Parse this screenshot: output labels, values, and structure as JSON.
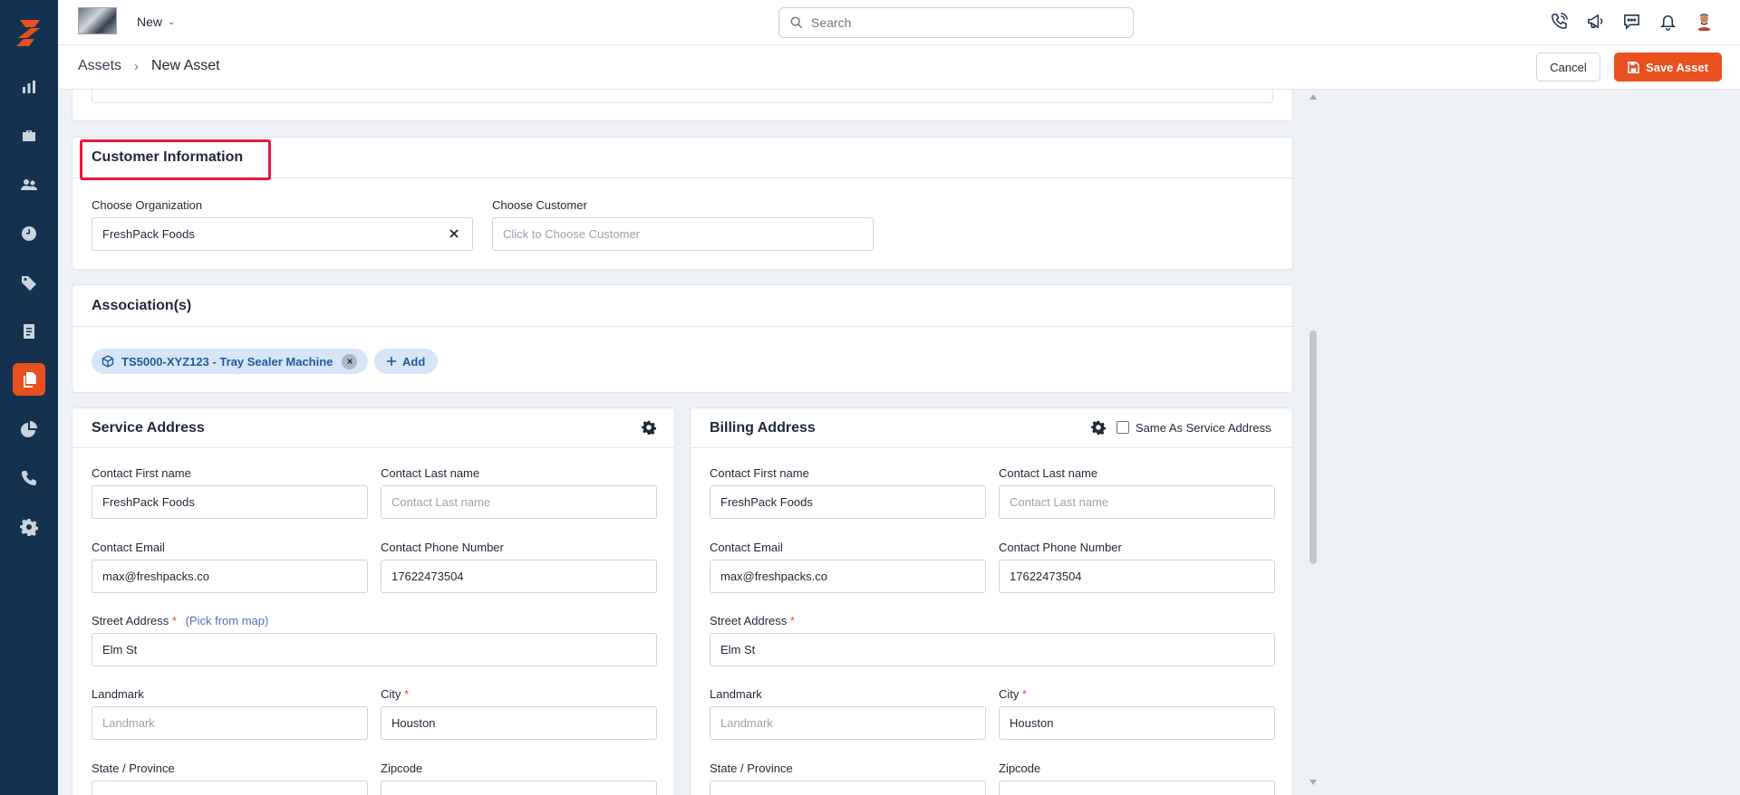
{
  "topbar": {
    "new_label": "New",
    "search_placeholder": "Search"
  },
  "breadcrumb": {
    "parent": "Assets",
    "separator": "›",
    "current": "New Asset"
  },
  "actions": {
    "cancel_label": "Cancel",
    "save_label": "Save Asset"
  },
  "customer_info": {
    "title": "Customer Information",
    "org_label": "Choose Organization",
    "org_value": "FreshPack Foods",
    "customer_label": "Choose Customer",
    "customer_placeholder": "Click to Choose Customer"
  },
  "associations": {
    "title": "Association(s)",
    "chip_label": "TS5000-XYZ123 - Tray Sealer Machine",
    "add_label": "Add"
  },
  "service_address": {
    "title": "Service Address",
    "first_name_label": "Contact First name",
    "first_name_value": "FreshPack Foods",
    "last_name_label": "Contact Last name",
    "last_name_placeholder": "Contact Last name",
    "email_label": "Contact Email",
    "email_value": "max@freshpacks.co",
    "phone_label": "Contact Phone Number",
    "phone_value": "17622473504",
    "street_label": "Street Address",
    "required_mark": "*",
    "pick_from_map": "(Pick from map)",
    "street_value": "Elm St",
    "landmark_label": "Landmark",
    "landmark_placeholder": "Landmark",
    "city_label": "City",
    "city_value": "Houston",
    "state_label": "State / Province",
    "zip_label": "Zipcode"
  },
  "billing_address": {
    "title": "Billing Address",
    "same_as_label": "Same As Service Address",
    "first_name_label": "Contact First name",
    "first_name_value": "FreshPack Foods",
    "last_name_label": "Contact Last name",
    "last_name_placeholder": "Contact Last name",
    "email_label": "Contact Email",
    "email_value": "max@freshpacks.co",
    "phone_label": "Contact Phone Number",
    "phone_value": "17622473504",
    "street_label": "Street Address",
    "required_mark": "*",
    "street_value": "Elm St",
    "landmark_label": "Landmark",
    "landmark_placeholder": "Landmark",
    "city_label": "City",
    "city_value": "Houston",
    "state_label": "State / Province",
    "zip_label": "Zipcode"
  },
  "colors": {
    "sidebar": "#12324f",
    "accent": "#e8501f",
    "highlight": "#e8183c",
    "chip_bg": "#d7e6f6"
  },
  "icons": [
    "logo-icon",
    "chart-icon",
    "briefcase-icon",
    "users-icon",
    "clock-icon",
    "tag-icon",
    "document-icon",
    "files-icon",
    "pie-chart-icon",
    "phone-icon",
    "gear-icon",
    "search-icon",
    "phone-call-icon",
    "megaphone-icon",
    "chat-icon",
    "bell-icon",
    "avatar",
    "save-icon",
    "cube-icon",
    "close-icon",
    "plus-icon"
  ]
}
